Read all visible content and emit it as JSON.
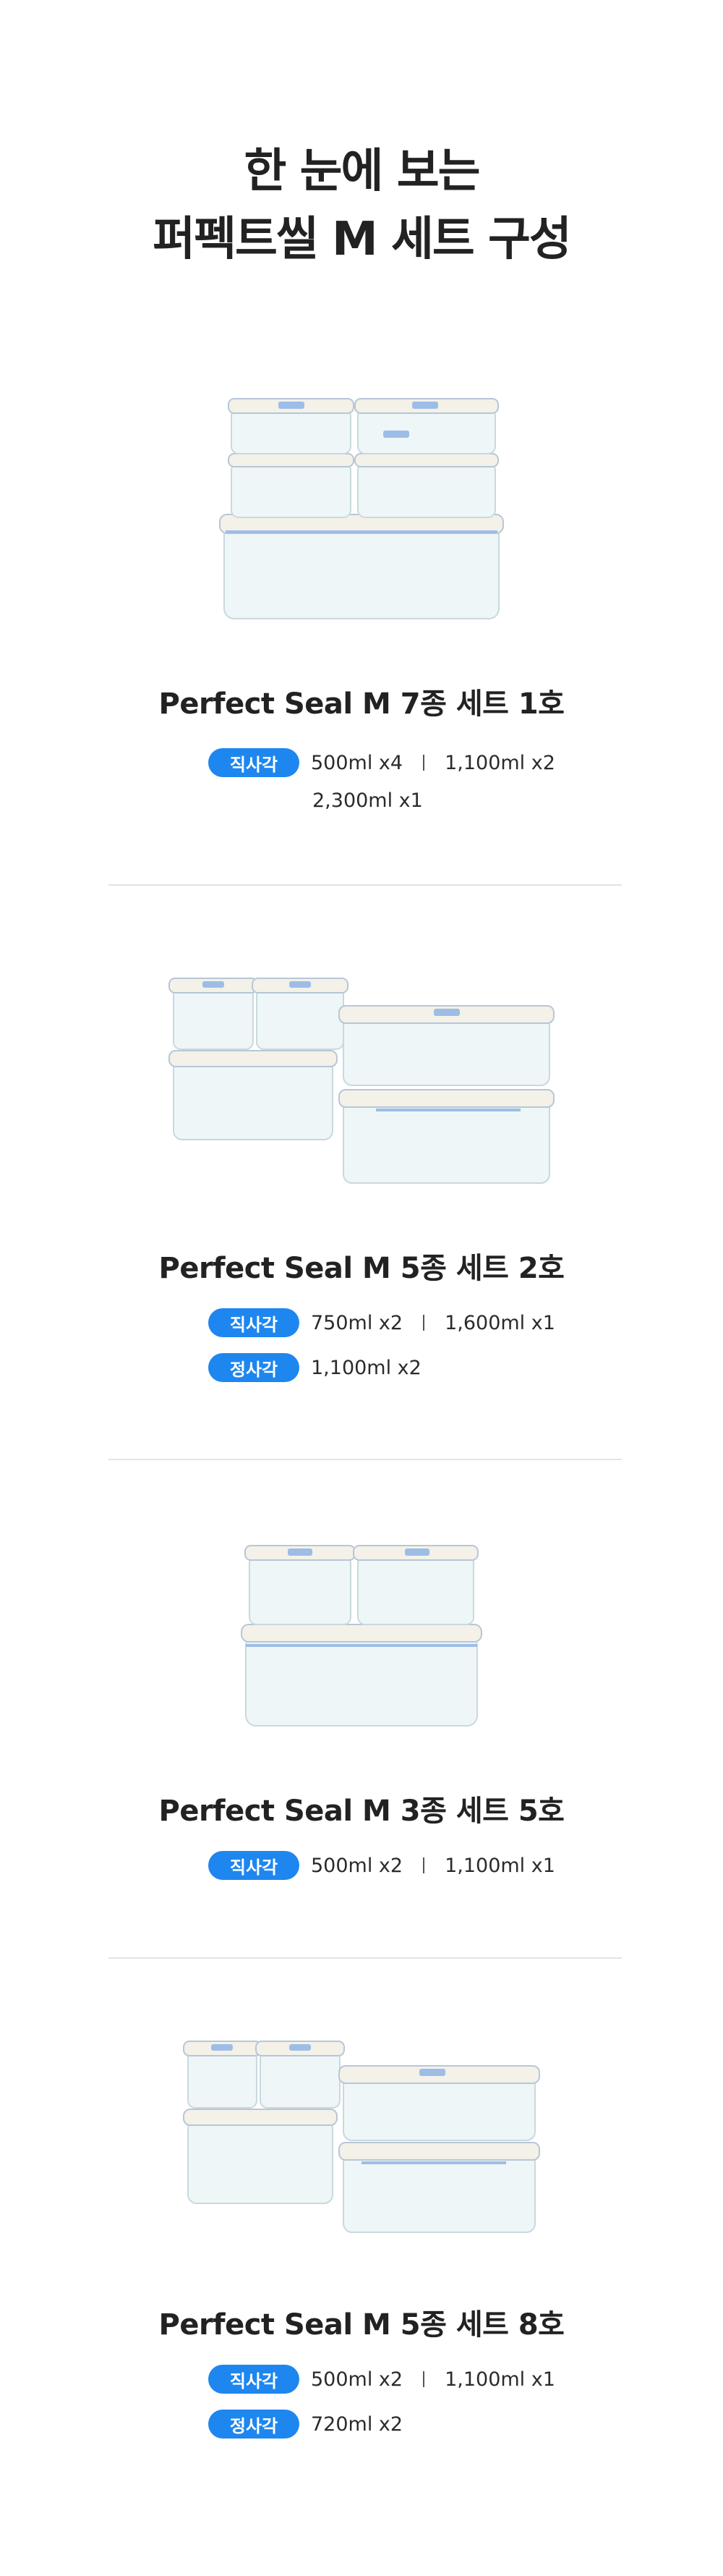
{
  "header": {
    "line1": "한 눈에 보는",
    "line2": "퍼펙트씰 M 세트 구성"
  },
  "sets": [
    {
      "title": "Perfect Seal M 7종 세트 1호",
      "rows": [
        {
          "badge": "직사각",
          "items": [
            "500ml x4",
            "1,100ml x2"
          ]
        }
      ],
      "extra": "2,300ml x1"
    },
    {
      "title": "Perfect Seal M 5종 세트 2호",
      "rows": [
        {
          "badge": "직사각",
          "items": [
            "750ml x2",
            "1,600ml x1"
          ]
        },
        {
          "badge": "정사각",
          "items": [
            "1,100ml x2"
          ]
        }
      ]
    },
    {
      "title": "Perfect Seal M 3종 세트 5호",
      "rows": [
        {
          "badge": "직사각",
          "items": [
            "500ml x2",
            "1,100ml x1"
          ]
        }
      ]
    },
    {
      "title": "Perfect Seal M 5종 세트 8호",
      "rows": [
        {
          "badge": "직사각",
          "items": [
            "500ml x2",
            "1,100ml x1"
          ]
        },
        {
          "badge": "정사각",
          "items": [
            "720ml x2"
          ]
        }
      ]
    }
  ],
  "colors": {
    "badge": "#1e86ef",
    "lid": "#f3f1e8",
    "glass": "#eef6f7",
    "clip": "#9dbde6",
    "divider": "#e3e3e3"
  }
}
